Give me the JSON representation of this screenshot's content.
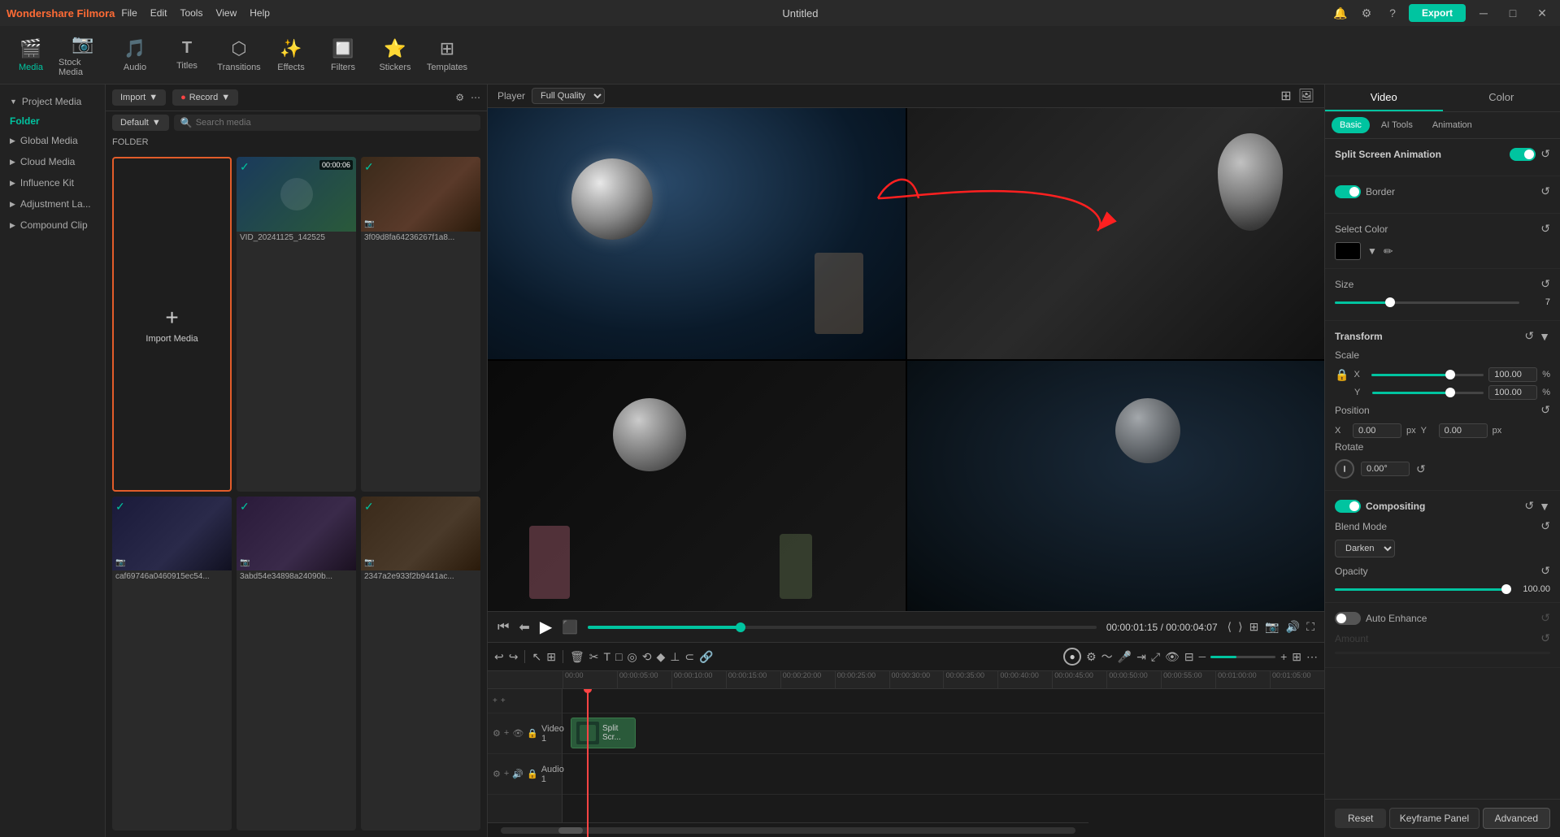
{
  "app": {
    "name": "Wondershare Filmora",
    "title": "Untitled",
    "export_label": "Export"
  },
  "titlebar": {
    "menus": [
      "File",
      "Edit",
      "Tools",
      "View",
      "Help"
    ]
  },
  "toolbar": {
    "items": [
      {
        "id": "media",
        "label": "Media",
        "icon": "🎬",
        "active": true
      },
      {
        "id": "stock",
        "label": "Stock Media",
        "icon": "📷"
      },
      {
        "id": "audio",
        "label": "Audio",
        "icon": "🎵"
      },
      {
        "id": "titles",
        "label": "Titles",
        "icon": "T"
      },
      {
        "id": "transitions",
        "label": "Transitions",
        "icon": "⬡"
      },
      {
        "id": "effects",
        "label": "Effects",
        "icon": "✨"
      },
      {
        "id": "filters",
        "label": "Filters",
        "icon": "🔲"
      },
      {
        "id": "stickers",
        "label": "Stickers",
        "icon": "⭐"
      },
      {
        "id": "templates",
        "label": "Templates",
        "icon": "⊞"
      }
    ]
  },
  "sidebar": {
    "items": [
      {
        "label": "Project Media",
        "arrow": "▶",
        "active": false
      },
      {
        "label": "Folder",
        "is_folder": true
      },
      {
        "label": "Global Media",
        "arrow": "▶"
      },
      {
        "label": "Cloud Media",
        "arrow": "▶"
      },
      {
        "label": "Influence Kit",
        "arrow": "▶"
      },
      {
        "label": "Adjustment La...",
        "arrow": "▶"
      },
      {
        "label": "Compound Clip",
        "arrow": "▶"
      }
    ]
  },
  "media_panel": {
    "import_btn": "Import",
    "record_btn": "Record",
    "default_label": "Default",
    "search_placeholder": "Search media",
    "folder_label": "FOLDER",
    "items": [
      {
        "type": "import",
        "label": "Import Media"
      },
      {
        "type": "video",
        "label": "VID_20241125_142525",
        "time": "00:00:06",
        "has_check": true
      },
      {
        "type": "image",
        "label": "3f09d8fa64236267f1a8...",
        "has_check": true
      },
      {
        "type": "image",
        "label": "caf69746a0460915ec54...",
        "has_check": true
      },
      {
        "type": "image",
        "label": "3abd54e34898a24090b...",
        "has_check": true
      },
      {
        "type": "image",
        "label": "2347a2e933f2b9441ac...",
        "has_check": true
      }
    ]
  },
  "preview": {
    "player_label": "Player",
    "quality": "Full Quality",
    "timecode_current": "00:00:01:15",
    "timecode_total": "00:00:04:07"
  },
  "right_panel": {
    "tabs": [
      "Video",
      "Color"
    ],
    "subtabs": [
      "Basic",
      "AI Tools",
      "Animation"
    ],
    "split_screen_animation": "Split Screen Animation",
    "border_label": "Border",
    "select_color_label": "Select Color",
    "size_label": "Size",
    "size_value": "7",
    "size_percent": 30,
    "transform_label": "Transform",
    "scale_label": "Scale",
    "scale_x_value": "100.00",
    "scale_y_value": "100.00",
    "scale_unit": "%",
    "position_label": "Position",
    "position_x_label": "X",
    "position_x_value": "0.00",
    "position_x_unit": "px",
    "position_y_label": "Y",
    "position_y_value": "0.00",
    "position_y_unit": "px",
    "rotate_label": "Rotate",
    "rotate_value": "0.00°",
    "compositing_label": "Compositing",
    "blend_mode_label": "Blend Mode",
    "blend_mode_value": "Darken",
    "opacity_label": "Opacity",
    "opacity_value": "100.00",
    "auto_enhance_label": "Auto Enhance",
    "amount_label": "Amount",
    "reset_btn": "Reset",
    "keyframe_panel_btn": "Keyframe Panel",
    "advanced_btn": "Advanced"
  },
  "timeline": {
    "track_labels": [
      {
        "name": "Video 1"
      },
      {
        "name": "Audio 1"
      }
    ],
    "ruler_marks": [
      "00:00",
      "00:00:05:00",
      "00:00:10:00",
      "00:00:15:00",
      "00:00:20:00",
      "00:00:25:00",
      "00:00:30:00",
      "00:00:35:00",
      "00:00:40:00",
      "00:00:45:00",
      "00:00:50:00",
      "00:00:55:00",
      "00:01:00:00",
      "00:01:05:00"
    ],
    "clip_label": "Split Scr..."
  }
}
